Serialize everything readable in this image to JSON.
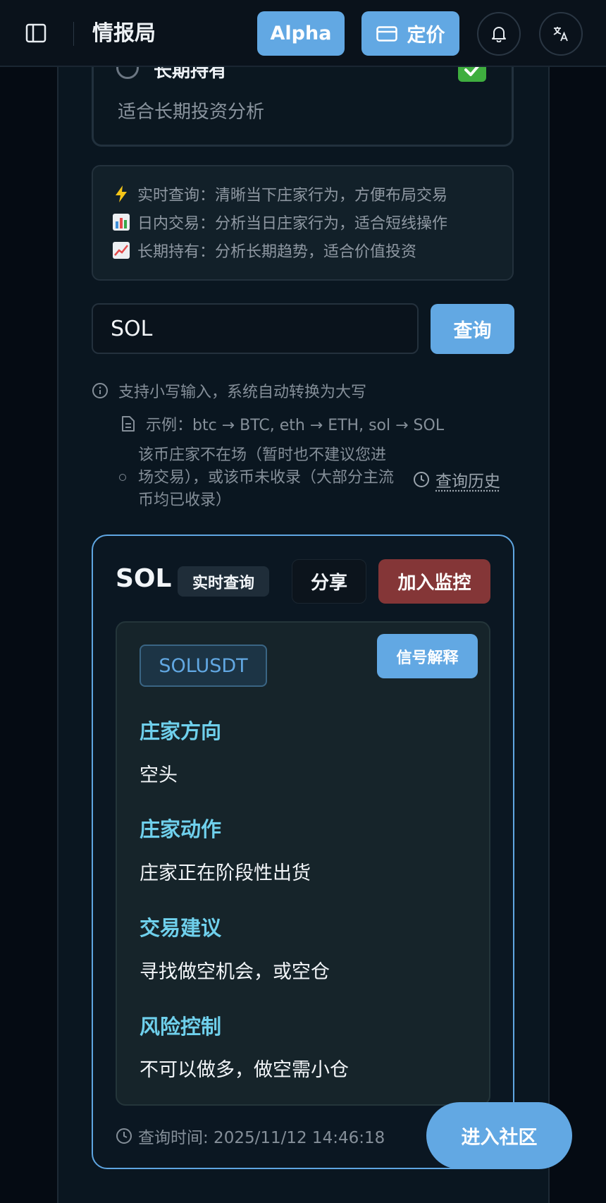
{
  "header": {
    "title": "情报局",
    "alpha_label": "Alpha",
    "pricing_label": "定价"
  },
  "mode_option": {
    "label": "长期持有",
    "description": "适合长期投资分析",
    "selected": true
  },
  "mode_info": [
    {
      "icon": "⚡",
      "icon_name": "lightning-icon",
      "text": "实时查询：清晰当下庄家行为，方便布局交易"
    },
    {
      "icon": "📊",
      "icon_name": "bar-chart-icon",
      "text": "日内交易：分析当日庄家行为，适合短线操作"
    },
    {
      "icon": "📈",
      "icon_name": "trend-up-icon",
      "text": "长期持有：分析长期趋势，适合价值投资"
    }
  ],
  "search": {
    "value": "SOL",
    "button_label": "查询"
  },
  "hints": {
    "uppercase": "支持小写输入，系统自动转换为大写",
    "example": "示例：btc → BTC, eth → ETH, sol → SOL",
    "notice": "该币庄家不在场（暂时也不建议您进场交易），或该币未收录（大部分主流币均已收录）",
    "history_label": "查询历史"
  },
  "result": {
    "symbol": "SOL",
    "mode_badge": "实时查询",
    "share_label": "分享",
    "monitor_label": "加入监控",
    "pair": "SOLUSDT",
    "explain_label": "信号解释",
    "sections": [
      {
        "title": "庄家方向",
        "text": "空头"
      },
      {
        "title": "庄家动作",
        "text": "庄家正在阶段性出货"
      },
      {
        "title": "交易建议",
        "text": "寻找做空机会，或空仓"
      },
      {
        "title": "风险控制",
        "text": "不可以做多，做空需小仓"
      }
    ],
    "query_time": "查询时间: 2025/11/12 14:46:18"
  },
  "community_label": "进入社区",
  "colors": {
    "accent": "#62a8e3",
    "danger": "#843637",
    "section_title": "#6fd0ec",
    "background": "#050b13"
  }
}
